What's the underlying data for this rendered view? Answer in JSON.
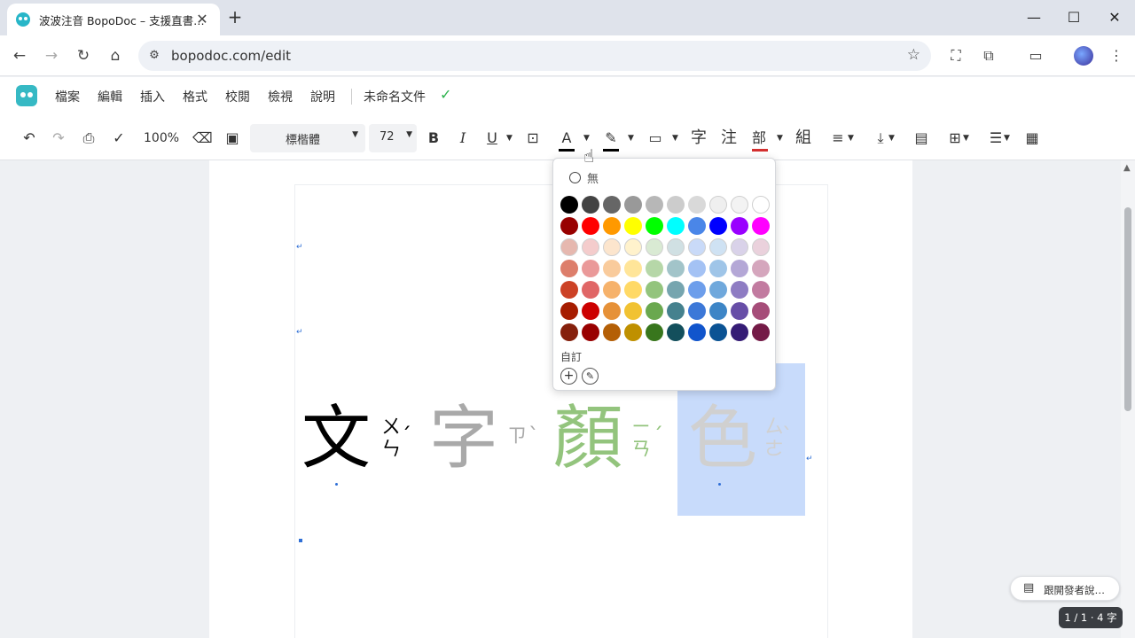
{
  "browser": {
    "tab_title": "波波注音 BopoDoc – 支援直書…",
    "tab_close": "✕",
    "new_tab": "+",
    "url": "bopodoc.com/edit",
    "window_controls": [
      "—",
      "☐",
      "✕"
    ]
  },
  "app": {
    "menu": [
      "檔案",
      "編輯",
      "插入",
      "格式",
      "校閱",
      "檢視",
      "說明"
    ],
    "doc_name": "未命名文件",
    "saved_icon": "✓"
  },
  "toolbar": {
    "zoom": "100%",
    "font": "標楷體",
    "size": "72",
    "bold": "B",
    "italic": "I",
    "underline": "U",
    "text_color": "A",
    "btn_char": "字",
    "btn_note": "注",
    "btn_radical": "部",
    "btn_group": "組",
    "text_color_bar": "#000000",
    "highlight_bar": "#000000",
    "radical_bar": "#d32f2f"
  },
  "document": {
    "chars": [
      {
        "char": "文",
        "zhuyin": [
          "ㄨ",
          "ㄣ"
        ],
        "tone": "ˊ",
        "color": "#000000"
      },
      {
        "char": "字",
        "zhuyin": [
          "ㄗ",
          ""
        ],
        "tone": "ˋ",
        "color": "#a9a9a9"
      },
      {
        "char": "顏",
        "zhuyin": [
          "ㄧ",
          "ㄢ"
        ],
        "tone": "ˊ",
        "color": "#93c47d"
      },
      {
        "char": "色",
        "zhuyin": [
          "ㄙ",
          "ㄜ"
        ],
        "tone": "ˋ",
        "color": "#d0d0d0"
      }
    ],
    "para_mark": "↵"
  },
  "color_picker": {
    "none_label": "無",
    "custom_label": "自訂",
    "add_label": "+",
    "eyedropper_label": "✎",
    "rows": [
      [
        "#000000",
        "#434343",
        "#666666",
        "#999999",
        "#b7b7b7",
        "#cccccc",
        "#d9d9d9",
        "#efefef",
        "#f3f3f3",
        "#ffffff"
      ],
      [
        "#980000",
        "#ff0000",
        "#ff9900",
        "#ffff00",
        "#00ff00",
        "#00ffff",
        "#4a86e8",
        "#0000ff",
        "#9900ff",
        "#ff00ff"
      ],
      [
        "#e6b8af",
        "#f4cccc",
        "#fce5cd",
        "#fff2cc",
        "#d9ead3",
        "#d0e0e3",
        "#c9daf8",
        "#cfe2f3",
        "#d9d2e9",
        "#ead1dc"
      ],
      [
        "#dd7e6b",
        "#ea9999",
        "#f9cb9c",
        "#ffe599",
        "#b6d7a8",
        "#a2c4c9",
        "#a4c2f4",
        "#9fc5e8",
        "#b4a7d6",
        "#d5a6bd"
      ],
      [
        "#cc4125",
        "#e06666",
        "#f6b26b",
        "#ffd966",
        "#93c47d",
        "#76a5af",
        "#6d9eeb",
        "#6fa8dc",
        "#8e7cc3",
        "#c27ba0"
      ],
      [
        "#a61c00",
        "#cc0000",
        "#e69138",
        "#f1c232",
        "#6aa84f",
        "#45818e",
        "#3c78d8",
        "#3d85c6",
        "#674ea7",
        "#a64d79"
      ],
      [
        "#85200c",
        "#990000",
        "#b45f06",
        "#bf9000",
        "#38761d",
        "#134f5c",
        "#1155cc",
        "#0b5394",
        "#351c75",
        "#741b47"
      ]
    ]
  },
  "feedback": {
    "icon": "▤",
    "label": "跟開發者說…"
  },
  "status": "1 / 1 · 4 字"
}
